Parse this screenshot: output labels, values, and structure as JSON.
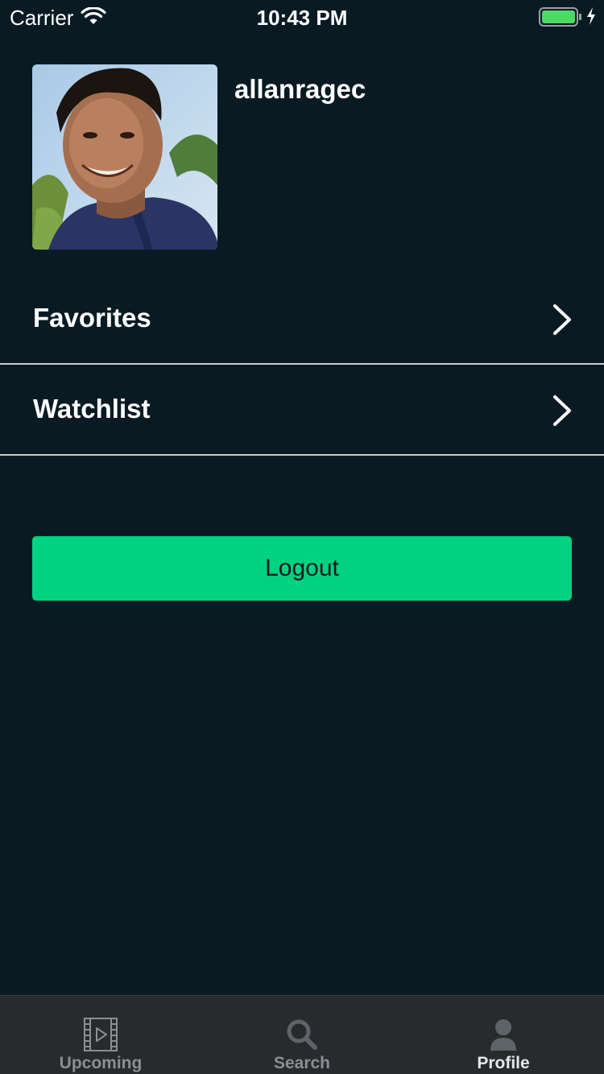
{
  "status_bar": {
    "carrier": "Carrier",
    "time": "10:43 PM",
    "battery_color": "#4cd964"
  },
  "profile": {
    "username": "allanragec"
  },
  "menu": {
    "items": [
      {
        "label": "Favorites",
        "icon": "chevron-right-icon"
      },
      {
        "label": "Watchlist",
        "icon": "chevron-right-icon"
      }
    ]
  },
  "logout": {
    "label": "Logout",
    "color": "#00d27f"
  },
  "tab_bar": {
    "tabs": [
      {
        "label": "Upcoming",
        "icon": "film-strip-icon",
        "active": false
      },
      {
        "label": "Search",
        "icon": "search-icon",
        "active": false
      },
      {
        "label": "Profile",
        "icon": "person-icon",
        "active": true
      }
    ]
  },
  "colors": {
    "background": "#0a1a23",
    "tab_bar": "#272b2e",
    "separator": "#c7ccd0"
  }
}
